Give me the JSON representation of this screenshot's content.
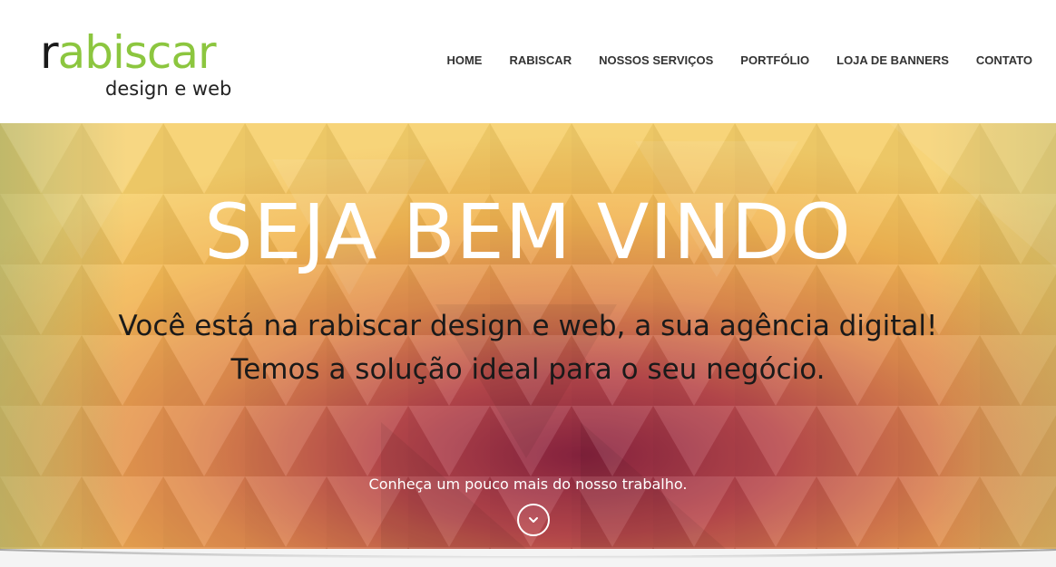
{
  "logo": {
    "first_letter": "r",
    "rest": "abiscar",
    "tagline": "design e web"
  },
  "nav": {
    "items": [
      {
        "label": "HOME"
      },
      {
        "label": "RABISCAR"
      },
      {
        "label": "NOSSOS SERVIÇOS"
      },
      {
        "label": "PORTFÓLIO"
      },
      {
        "label": "LOJA DE BANNERS"
      },
      {
        "label": "CONTATO"
      }
    ]
  },
  "hero": {
    "title": "SEJA BEM VINDO",
    "subtitle_line1": "Você está na rabiscar design e web, a sua agência digital!",
    "subtitle_line2": "Temos a solução ideal para o seu negócio.",
    "cta": "Conheça um pouco mais do nosso trabalho.",
    "scroll_icon": "chevron-down-icon"
  },
  "colors": {
    "brand_green": "#8cc63f",
    "nav_text": "#333333",
    "hero_title": "#ffffff",
    "hero_subtitle": "#1a1a1a"
  }
}
